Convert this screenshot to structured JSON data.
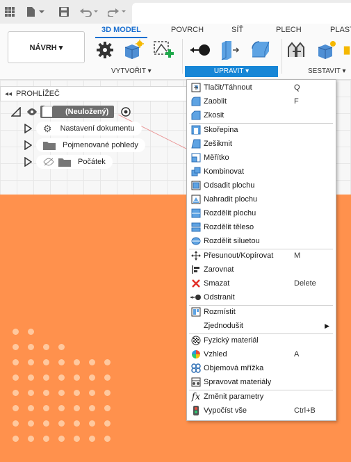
{
  "quick_access": {
    "icons": [
      "apps-grid-icon",
      "file-icon",
      "save-icon",
      "undo-icon",
      "redo-icon"
    ]
  },
  "ribbon": {
    "workspace": "NÁVRH ▾",
    "tabs": [
      "3D MODEL",
      "POVRCH",
      "SÍŤ",
      "PLECH",
      "PLAST"
    ],
    "active_tab": "3D MODEL",
    "groups": {
      "create": "VYTVOŘIT ▾",
      "modify": "UPRAVIT ▾",
      "assemble": "SESTAVIT ▾"
    }
  },
  "browser": {
    "title": "PROHLÍŽEČ",
    "root": "(Neuložený)",
    "items": [
      "Nastavení dokumentu",
      "Pojmenované pohledy",
      "Počátek"
    ]
  },
  "menu": {
    "items": [
      {
        "label": "Tlačit/Táhnout",
        "shortcut": "Q",
        "icon": "press-pull-icon"
      },
      {
        "label": "Zaoblit",
        "shortcut": "F",
        "icon": "fillet-icon"
      },
      {
        "label": "Zkosit",
        "shortcut": "",
        "icon": "chamfer-icon"
      },
      {
        "label": "Skořepina",
        "shortcut": "",
        "icon": "shell-icon"
      },
      {
        "label": "Zešikmit",
        "shortcut": "",
        "icon": "draft-icon"
      },
      {
        "label": "Měřítko",
        "shortcut": "",
        "icon": "scale-icon"
      },
      {
        "label": "Kombinovat",
        "shortcut": "",
        "icon": "combine-icon"
      },
      {
        "label": "Odsadit plochu",
        "shortcut": "",
        "icon": "offset-face-icon"
      },
      {
        "label": "Nahradit plochu",
        "shortcut": "",
        "icon": "replace-face-icon"
      },
      {
        "label": "Rozdělit plochu",
        "shortcut": "",
        "icon": "split-face-icon"
      },
      {
        "label": "Rozdělit těleso",
        "shortcut": "",
        "icon": "split-body-icon"
      },
      {
        "label": "Rozdělit siluetou",
        "shortcut": "",
        "icon": "silhouette-split-icon"
      },
      {
        "label": "Přesunout/Kopírovat",
        "shortcut": "M",
        "icon": "move-copy-icon"
      },
      {
        "label": "Zarovnat",
        "shortcut": "",
        "icon": "align-icon"
      },
      {
        "label": "Smazat",
        "shortcut": "Delete",
        "icon": "delete-icon"
      },
      {
        "label": "Odstranit",
        "shortcut": "",
        "icon": "remove-icon"
      },
      {
        "label": "Rozmístit",
        "shortcut": "",
        "icon": "arrange-icon"
      },
      {
        "label": "Zjednodušit",
        "shortcut": "",
        "icon": "simplify-icon"
      },
      {
        "label": "Fyzický materiál",
        "shortcut": "",
        "icon": "physical-material-icon"
      },
      {
        "label": "Vzhled",
        "shortcut": "A",
        "icon": "appearance-icon"
      },
      {
        "label": "Objemová mřížka",
        "shortcut": "",
        "icon": "volumetric-lattice-icon"
      },
      {
        "label": "Spravovat materiály",
        "shortcut": "",
        "icon": "manage-materials-icon"
      },
      {
        "label": "Změnit parametry",
        "shortcut": "",
        "icon": "change-parameters-icon"
      },
      {
        "label": "Vypočíst vše",
        "shortcut": "Ctrl+B",
        "icon": "compute-all-icon"
      }
    ]
  }
}
